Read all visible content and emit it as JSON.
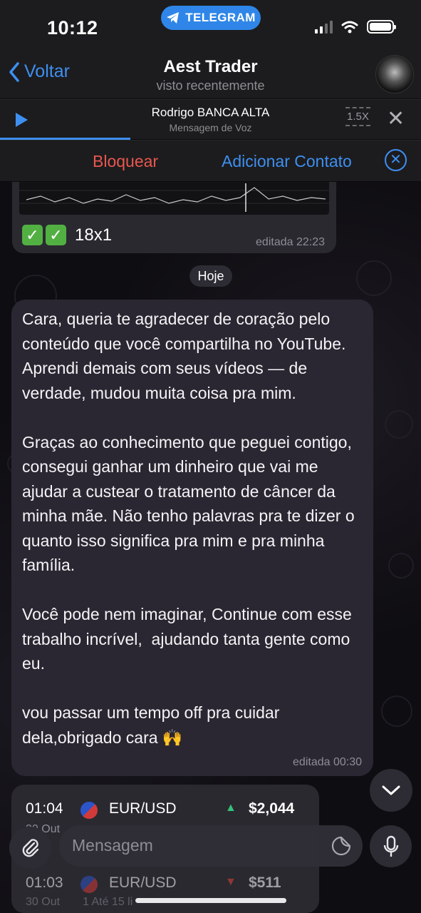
{
  "status_bar": {
    "time": "10:12",
    "telegram_pill": "TELEGRAM"
  },
  "header": {
    "back_label": "Voltar",
    "title": "Aest Trader",
    "subtitle": "visto recentemente"
  },
  "voice_player": {
    "sender": "Rodrigo BANCA ALTA",
    "type": "Mensagem de Voz",
    "speed": "1.5X",
    "progress_percent": 31
  },
  "action_bar": {
    "block_label": "Bloquear",
    "add_contact_label": "Adicionar Contato"
  },
  "previous_message": {
    "caption": "18x1",
    "time": "editada 22:23"
  },
  "date_separator": "Hoje",
  "message": {
    "text": "Cara, queria te agradecer de coração pelo conteúdo que você compartilha no YouTube. Aprendi demais com seus vídeos — de verdade, mudou muita coisa pra mim.\n\nGraças ao conhecimento que peguei contigo, consegui ganhar um dinheiro que vai me ajudar a custear o tratamento de câncer da minha mãe. Não tenho palavras pra te dizer o quanto isso significa pra mim e pra minha família.\n\nVocê pode nem imaginar, Continue com esse trabalho incrível,  ajudando tanta gente como eu.\n\nvou passar um tempo off pra cuidar dela,obrigado cara 🙌",
    "time": "editada 00:30"
  },
  "trades": [
    {
      "time": "01:04",
      "date": "30 Out",
      "pair": "EUR/USD",
      "direction": "▲",
      "direction_color": "#35c27a",
      "amount": "$2,044",
      "detail": ""
    },
    {
      "time": "01:03",
      "date": "30 Out",
      "pair": "EUR/USD",
      "direction": "▼",
      "direction_color": "#e0443a",
      "amount": "$511",
      "detail": "1 Até 15 li"
    }
  ],
  "input": {
    "placeholder": "Mensagem"
  },
  "colors": {
    "accent": "#3e8ff0",
    "danger": "#e9574e",
    "bubble": "#2b2732"
  }
}
